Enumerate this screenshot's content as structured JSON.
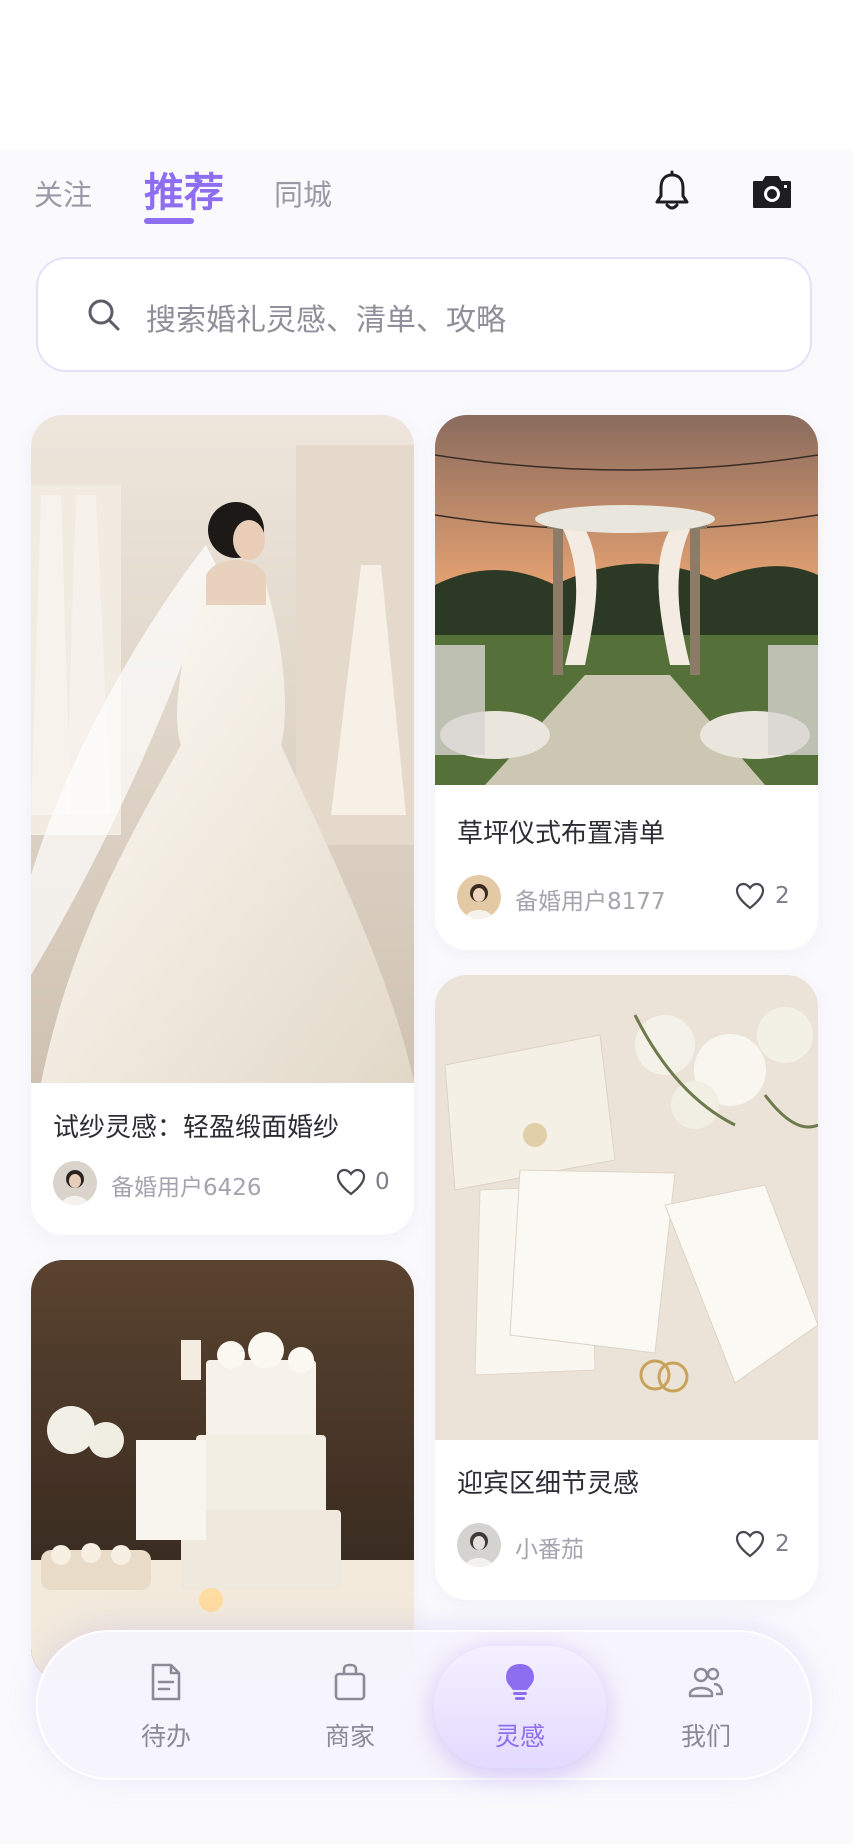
{
  "header": {
    "tabs": [
      {
        "label": "关注",
        "active": false
      },
      {
        "label": "推荐",
        "active": true
      },
      {
        "label": "同城",
        "active": false
      }
    ],
    "icons": [
      "bell-icon",
      "camera-icon"
    ]
  },
  "search": {
    "placeholder": "搜索婚礼灵感、清单、攻略"
  },
  "feed": {
    "cards": [
      {
        "title": "试纱灵感：轻盈缎面婚纱",
        "user": "备婚用户6426",
        "likes": "0"
      },
      {
        "title": "草坪仪式布置清单",
        "user": "备婚用户8177",
        "likes": "2"
      },
      {
        "title": "迎宾区细节灵感",
        "user": "小番茄",
        "likes": "2"
      },
      {
        "title": "",
        "user": "",
        "likes": ""
      }
    ]
  },
  "nav": {
    "items": [
      {
        "label": "待办",
        "icon": "document-icon"
      },
      {
        "label": "商家",
        "icon": "shopping-bag-icon"
      },
      {
        "label": "灵感",
        "icon": "lightbulb-icon"
      },
      {
        "label": "我们",
        "icon": "users-icon"
      }
    ],
    "active_index": 2
  },
  "colors": {
    "accent": "#8d6df0",
    "background": "#fafafd",
    "muted_text": "#9a99a6"
  }
}
